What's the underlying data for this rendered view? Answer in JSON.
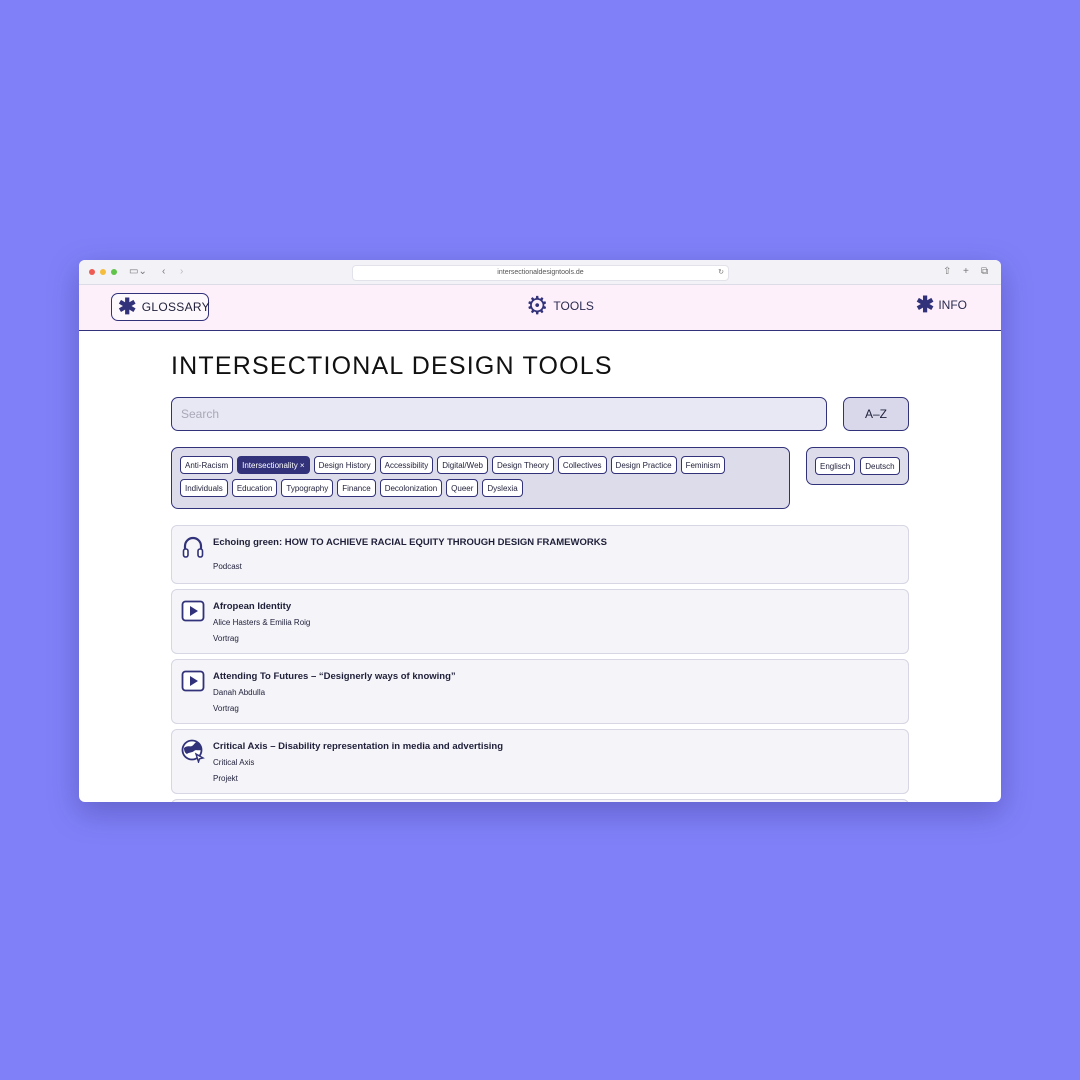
{
  "browser": {
    "url": "intersectionaldesigntools.de"
  },
  "nav": {
    "glossary_label": "GLOSSARY",
    "tools_label": "TOOLS",
    "info_label": "INFO"
  },
  "page": {
    "title": "INTERSECTIONAL DESIGN TOOLS"
  },
  "search": {
    "placeholder": "Search",
    "value": "",
    "sort_label": "A–Z"
  },
  "tags": {
    "row1": [
      {
        "label": "Anti-Racism",
        "active": false
      },
      {
        "label": "Intersectionality ×",
        "active": true
      },
      {
        "label": "Design History",
        "active": false
      },
      {
        "label": "Accessibility",
        "active": false
      },
      {
        "label": "Digital/Web",
        "active": false
      },
      {
        "label": "Design Theory",
        "active": false
      },
      {
        "label": "Collectives",
        "active": false
      },
      {
        "label": "Design Practice",
        "active": false
      },
      {
        "label": "Feminism",
        "active": false
      }
    ],
    "row2": [
      {
        "label": "Individuals",
        "active": false
      },
      {
        "label": "Education",
        "active": false
      },
      {
        "label": "Typography",
        "active": false
      },
      {
        "label": "Finance",
        "active": false
      },
      {
        "label": "Decolonization",
        "active": false
      },
      {
        "label": "Queer",
        "active": false
      },
      {
        "label": "Dyslexia",
        "active": false
      }
    ]
  },
  "languages": [
    "Englisch",
    "Deutsch"
  ],
  "results": [
    {
      "icon": "headphones-icon",
      "title": "Echoing green: HOW TO ACHIEVE RACIAL EQUITY THROUGH DESIGN FRAMEWORKS",
      "author": "",
      "type": "Podcast"
    },
    {
      "icon": "play-icon",
      "title": "Afropean Identity",
      "author": "Alice Hasters & Emilia Roig",
      "type": "Vortrag"
    },
    {
      "icon": "play-icon",
      "title": "Attending To Futures – “Designerly ways of knowing”",
      "author": "Danah Abdulla",
      "type": "Vortrag"
    },
    {
      "icon": "globe-cursor-icon",
      "title": "Critical Axis – Disability representation in media and advertising",
      "author": "Critical Axis",
      "type": "Projekt"
    }
  ]
}
